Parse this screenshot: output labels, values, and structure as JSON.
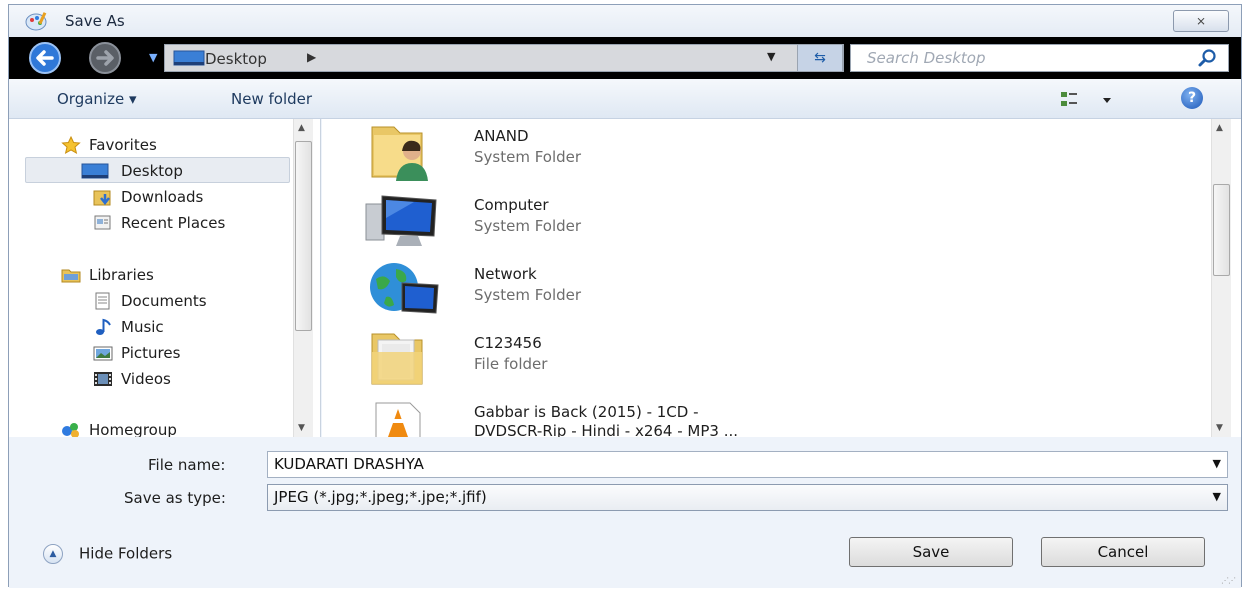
{
  "window": {
    "title": "Save As",
    "close_glyph": "⨯"
  },
  "address": {
    "location": "Desktop",
    "search_placeholder": "Search Desktop"
  },
  "toolbar": {
    "organize_label": "Organize ▾",
    "new_folder_label": "New folder",
    "help_glyph": "?"
  },
  "navigation": [
    {
      "label": "Favorites",
      "icon": "star-icon",
      "group": true
    },
    {
      "label": "Desktop",
      "icon": "desktop-icon",
      "selected": true
    },
    {
      "label": "Downloads",
      "icon": "downloads-icon"
    },
    {
      "label": "Recent Places",
      "icon": "recent-places-icon"
    },
    {
      "label": "Libraries",
      "icon": "libraries-icon",
      "group": true
    },
    {
      "label": "Documents",
      "icon": "documents-icon"
    },
    {
      "label": "Music",
      "icon": "music-icon"
    },
    {
      "label": "Pictures",
      "icon": "pictures-icon"
    },
    {
      "label": "Videos",
      "icon": "videos-icon"
    },
    {
      "label": "Homegroup",
      "icon": "homegroup-icon",
      "group": true
    }
  ],
  "files": [
    {
      "name": "ANAND",
      "type": "System Folder",
      "icon": "user-folder-icon"
    },
    {
      "name": "Computer",
      "type": "System Folder",
      "icon": "computer-icon"
    },
    {
      "name": "Network",
      "type": "System Folder",
      "icon": "network-icon"
    },
    {
      "name": "C123456",
      "type": "File folder",
      "icon": "folder-icon"
    },
    {
      "name": "Gabbar is Back (2015) - 1CD -",
      "type": "DVDSCR-Rip - Hindi - x264 - MP3 ...",
      "icon": "vlc-file-icon"
    }
  ],
  "form": {
    "file_name_label": "File name:",
    "file_name_value": "KUDARATI DRASHYA",
    "save_type_label": "Save as type:",
    "save_type_value": "JPEG (*.jpg;*.jpeg;*.jpe;*.jfif)"
  },
  "buttons": {
    "hide_folders": "Hide Folders",
    "save": "Save",
    "cancel": "Cancel"
  },
  "colors": {
    "accent": "#1b57b8",
    "window_bg": "#eef3fa",
    "address_bar": "#000000"
  }
}
